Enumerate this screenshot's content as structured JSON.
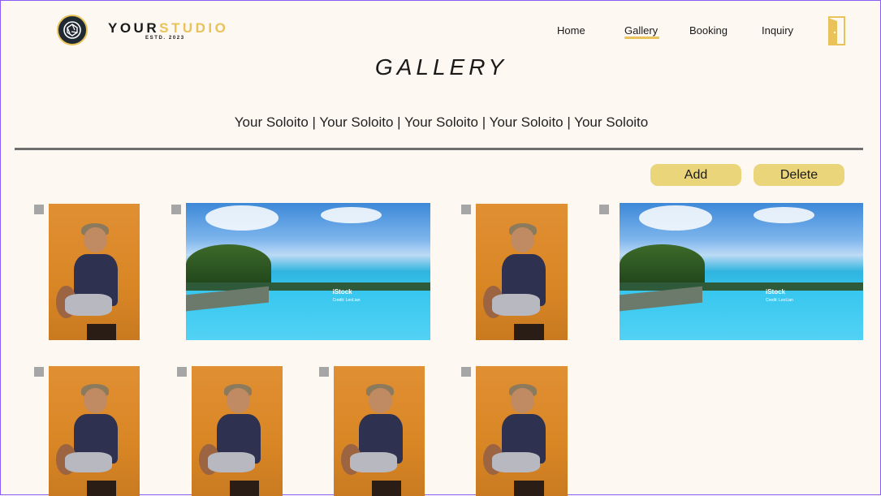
{
  "brand": {
    "part1": "YOUR",
    "part2": "STUDIO",
    "tagline": "ESTD. 2023"
  },
  "nav": {
    "items": [
      {
        "label": "Home"
      },
      {
        "label": "Gallery"
      },
      {
        "label": "Booking"
      },
      {
        "label": "Inquiry"
      }
    ],
    "active": "Gallery"
  },
  "page": {
    "title": "GALLERY",
    "subtitle": "Your Soloito | Your Soloito | Your Soloito | Your Soloito | Your Soloito"
  },
  "actions": {
    "add_label": "Add",
    "delete_label": "Delete"
  },
  "gallery": {
    "photos": [
      {
        "type": "portrait"
      },
      {
        "type": "beach",
        "watermark": "iStock",
        "credit": "Credit: LeoLian"
      },
      {
        "type": "portrait"
      },
      {
        "type": "beach",
        "watermark": "iStock",
        "credit": "Credit: LeoLian"
      },
      {
        "type": "portrait"
      },
      {
        "type": "portrait"
      },
      {
        "type": "portrait"
      },
      {
        "type": "portrait"
      }
    ]
  },
  "colors": {
    "background": "#fdf8f1",
    "accent": "#e9c25a",
    "button": "#ead57a",
    "divider": "#6e6e6e"
  },
  "icons": {
    "logo": "camera-aperture-icon",
    "logout": "door-icon",
    "select": "checkbox-icon"
  }
}
